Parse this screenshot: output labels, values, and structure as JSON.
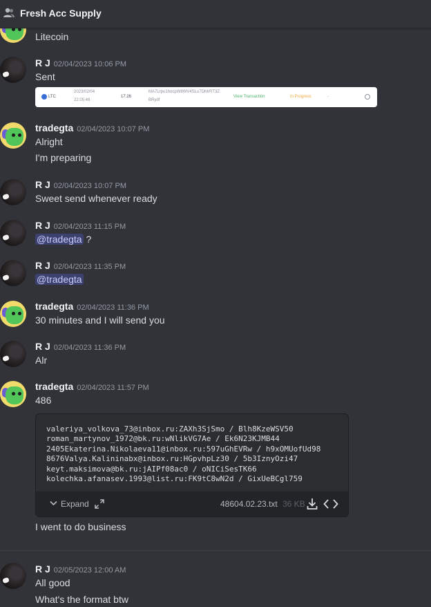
{
  "channel": {
    "title": "Fresh Acc Supply",
    "icon": "people-icon"
  },
  "messages": {
    "m0": {
      "text": "Litecoin"
    },
    "m1": {
      "author": "R J",
      "timestamp": "02/04/2023 10:06 PM",
      "text": "Sent",
      "embed": {
        "coin": "LTC",
        "date": "2023/02/04",
        "time": "22:05:48",
        "amount": "17.26",
        "address_1": "MA7Lrpu1hocpW8WV4SLu7DMrRT3Z",
        "address_2": "BRydf",
        "link": "View Transaction",
        "status": "In Progress",
        "dash": "-"
      }
    },
    "m2": {
      "author": "tradegta",
      "timestamp": "02/04/2023 10:07 PM",
      "text1": "Alright",
      "text2": "I'm preparing"
    },
    "m3": {
      "author": "R J",
      "timestamp": "02/04/2023 10:07 PM",
      "text": "Sweet send whenever ready"
    },
    "m4": {
      "author": "R J",
      "timestamp": "02/04/2023 11:15 PM",
      "mention": "@tradegta",
      "text": " ?"
    },
    "m5": {
      "author": "R J",
      "timestamp": "02/04/2023 11:35 PM",
      "mention": "@tradegta"
    },
    "m6": {
      "author": "tradegta",
      "timestamp": "02/04/2023 11:36 PM",
      "text": "30 minutes and I will send you"
    },
    "m7": {
      "author": "R J",
      "timestamp": "02/04/2023 11:36 PM",
      "text": "Alr"
    },
    "m8": {
      "author": "tradegta",
      "timestamp": "02/04/2023 11:57 PM",
      "text": "486",
      "file": {
        "lines": [
          "valeriya_volkova_73@inbox.ru:ZAXh3SjSmo / Blh8KzeWSV50",
          "roman_martynov_1972@bk.ru:wNlikVG7Ae / Ek6N23KJMB44",
          "2405Ekaterina.Nikolaeva11@inbox.ru:597uGhEVRw / h9xOMUofUd98",
          "8676Valya.Kalininabx@inbox.ru:HGpvhpLz30 / 5b3IznyOzi47",
          "keyt.maksimova@bk.ru:jAIPf08ac0 / oNICiSesTK66",
          "kolechka.afanasev.1993@list.ru:FK9tC8wN2d / GixUeBCgl759"
        ],
        "expand_label": "Expand",
        "filename": "48604.02.23.txt",
        "size": "36 KB"
      },
      "text_after": "I went to do business"
    },
    "m9": {
      "author": "R J",
      "timestamp": "02/05/2023 12:00 AM",
      "text1": "All good",
      "text2": "What's the format btw"
    }
  }
}
